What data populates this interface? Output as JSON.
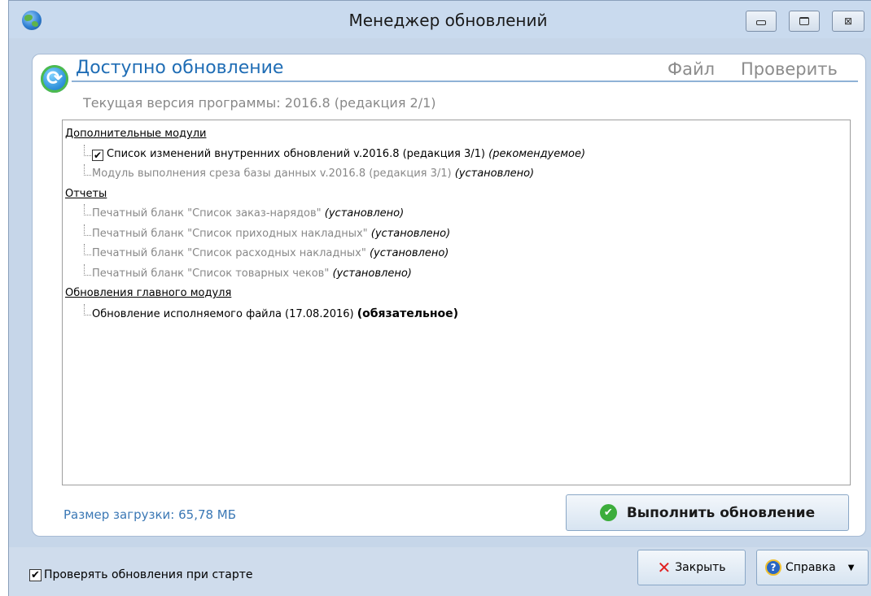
{
  "window": {
    "title": "Менеджер обновлений",
    "controls": {
      "minimize_icon": "minimize-icon",
      "maximize_icon": "maximize-icon",
      "close_glyph": "⊠"
    }
  },
  "header": {
    "title": "Доступно обновление",
    "menu": {
      "file": "Файл",
      "check": "Проверить"
    },
    "current_version": "Текущая версия программы: 2016.8 (редакция 2/1)"
  },
  "tree": {
    "groups": [
      {
        "label": "Дополнительные модули",
        "items": [
          {
            "text": "Список изменений внутренних обновлений v.2016.8 (редакция 3/1)",
            "status": "(рекомендуемое)",
            "checked": true
          },
          {
            "text": "Модуль выполнения среза базы данных v.2016.8 (редакция 3/1)",
            "status": "(установлено)"
          }
        ]
      },
      {
        "label": "Отчеты",
        "items": [
          {
            "text": "Печатный бланк \"Список заказ-нарядов\"",
            "status": "(установлено)"
          },
          {
            "text": "Печатный бланк \"Список приходных накладных\"",
            "status": "(установлено)"
          },
          {
            "text": "Печатный бланк \"Список расходных накладных\"",
            "status": "(установлено)"
          },
          {
            "text": "Печатный бланк \"Список товарных чеков\"",
            "status": "(установлено)"
          }
        ]
      },
      {
        "label": "Обновления главного модуля",
        "items": [
          {
            "text": "Обновление исполняемого файла (17.08.2016)",
            "status": "(обязательное)"
          }
        ]
      }
    ]
  },
  "download_size": "Размер загрузки: 65,78 МБ",
  "update_button": "Выполнить обновление",
  "footer": {
    "check_on_startup": "Проверять обновления при старте",
    "check_on_startup_checked": true,
    "close_button": "Закрыть",
    "help_button": "Справка"
  },
  "colors": {
    "accent": "#1f6db5",
    "bottom_bar": "#cfdcec",
    "ok_green": "#3cad3c",
    "close_red": "#e02020"
  }
}
